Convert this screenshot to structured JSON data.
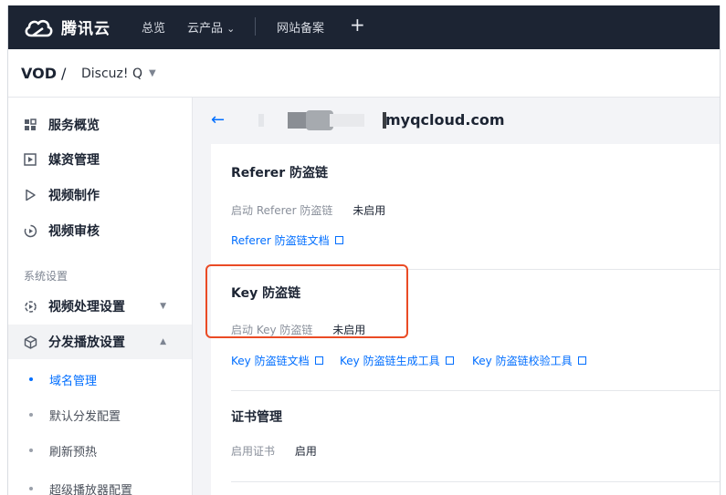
{
  "topbar": {
    "brand": "腾讯云",
    "nav": [
      "总览",
      "云产品",
      "网站备案"
    ],
    "cloud_products_caret": "⌄",
    "plus": "+"
  },
  "product": {
    "name": "VOD",
    "separator": "/",
    "app": "Discuz! Q"
  },
  "sidebar": {
    "items": [
      {
        "label": "服务概览",
        "icon": "grid-icon"
      },
      {
        "label": "媒资管理",
        "icon": "media-icon"
      },
      {
        "label": "视频制作",
        "icon": "play-icon"
      },
      {
        "label": "视频审核",
        "icon": "review-icon"
      }
    ],
    "section_title": "系统设置",
    "groups": [
      {
        "label": "视频处理设置",
        "icon": "process-icon"
      },
      {
        "label": "分发播放设置",
        "icon": "cube-icon"
      }
    ],
    "sub_items": [
      "域名管理",
      "默认分发配置",
      "刷新预热",
      "超级播放器配置"
    ]
  },
  "main": {
    "domain_suffix": "myqcloud.com",
    "referer": {
      "title": "Referer 防盗链",
      "label": "启动 Referer 防盗链",
      "value": "未启用",
      "doc_link": "Referer 防盗链文档"
    },
    "key": {
      "title": "Key 防盗链",
      "label": "启动 Key 防盗链",
      "value": "未启用",
      "links": [
        "Key 防盗链文档",
        "Key 防盗链生成工具",
        "Key 防盗链校验工具"
      ]
    },
    "cert": {
      "title": "证书管理",
      "label": "启用证书",
      "value": "启用"
    }
  },
  "colors": {
    "topbar_bg": "#1c2433",
    "link": "#006eff",
    "highlight": "#ea4b25"
  }
}
